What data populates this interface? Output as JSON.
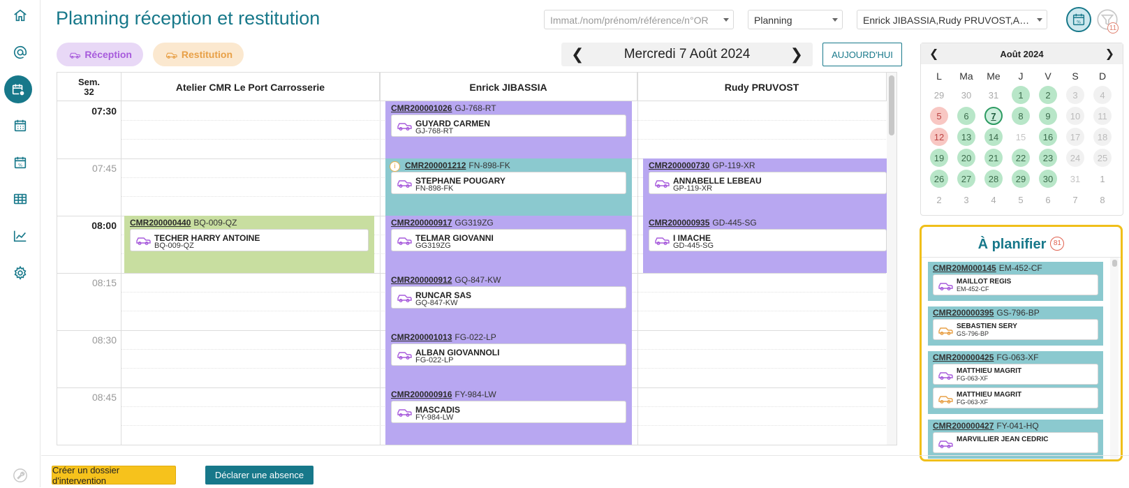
{
  "page": {
    "title": "Planning réception et restitution"
  },
  "header": {
    "search_placeholder": "Immat./nom/prénom/référence/n°OR",
    "view_select": "Planning",
    "people_select": "Enrick JIBASSIA,Rudy PRUVOST,Atel...",
    "filter_count": "11"
  },
  "chips": {
    "reception": "Réception",
    "restitution": "Restitution"
  },
  "date_nav": {
    "prev": "❮",
    "label": "Mercredi 7 Août 2024",
    "next": "❯",
    "today": "AUJOURD'HUI"
  },
  "grid": {
    "week_label": "Sem.",
    "week_number": "32",
    "columns": [
      "Atelier CMR Le Port Carrosserie",
      "Enrick JIBASSIA",
      "Rudy PRUVOST"
    ],
    "times": [
      "07:30",
      "07:45",
      "08:00",
      "08:15",
      "08:30",
      "08:45"
    ]
  },
  "appointments": {
    "e1": {
      "num": "CMR200001026",
      "plate": "GJ-768-RT",
      "name": "GUYARD CARMEN",
      "sub": "GJ-768-RT"
    },
    "e2": {
      "num": "CMR200001212",
      "plate": "FN-898-FK",
      "name": "STEPHANE POUGARY",
      "sub": "FN-898-FK",
      "info": "i"
    },
    "e3": {
      "num": "CMR200000917",
      "plate": "GG319ZG",
      "name": "TELMAR GIOVANNI",
      "sub": "GG319ZG"
    },
    "e4": {
      "num": "CMR200000912",
      "plate": "GQ-847-KW",
      "name": "RUNCAR SAS",
      "sub": "GQ-847-KW"
    },
    "e5": {
      "num": "CMR200001013",
      "plate": "FG-022-LP",
      "name": "ALBAN GIOVANNOLI",
      "sub": "FG-022-LP"
    },
    "e6": {
      "num": "CMR200000916",
      "plate": "FY-984-LW",
      "name": "MASCADIS",
      "sub": "FY-984-LW"
    },
    "a1": {
      "num": "CMR200000440",
      "plate": "BQ-009-QZ",
      "name": "TECHER HARRY ANTOINE",
      "sub": "BQ-009-QZ"
    },
    "r1": {
      "num": "CMR200000730",
      "plate": "GP-119-XR",
      "name": "ANNABELLE LEBEAU",
      "sub": "GP-119-XR"
    },
    "r2": {
      "num": "CMR200000935",
      "plate": "GD-445-SG",
      "name": "I IMACHE",
      "sub": "GD-445-SG"
    }
  },
  "mini_calendar": {
    "title": "Août 2024",
    "prev": "❮",
    "next": "❯",
    "dow": [
      "L",
      "Ma",
      "Me",
      "J",
      "V",
      "S",
      "D"
    ],
    "weeks": [
      [
        "29",
        "30",
        "31",
        "1",
        "2",
        "3",
        "4"
      ],
      [
        "5",
        "6",
        "7",
        "8",
        "9",
        "10",
        "11"
      ],
      [
        "12",
        "13",
        "14",
        "15",
        "16",
        "17",
        "18"
      ],
      [
        "19",
        "20",
        "21",
        "22",
        "23",
        "24",
        "25"
      ],
      [
        "26",
        "27",
        "28",
        "29",
        "30",
        "31",
        "1"
      ],
      [
        "2",
        "3",
        "4",
        "5",
        "6",
        "7",
        "8"
      ]
    ],
    "selected_day": "7"
  },
  "a_planifier": {
    "title": "À planifier",
    "count": "81",
    "items": [
      {
        "num": "CMR20M000145",
        "plate": "EM-452-CF",
        "cards": [
          {
            "type": "reception",
            "name": "MAILLOT REGIS",
            "sub": "EM-452-CF"
          }
        ]
      },
      {
        "num": "CMR200000395",
        "plate": "GS-796-BP",
        "cards": [
          {
            "type": "restitution",
            "name": "SEBASTIEN SERY",
            "sub": "GS-796-BP"
          }
        ]
      },
      {
        "num": "CMR200000425",
        "plate": "FG-063-XF",
        "cards": [
          {
            "type": "reception",
            "name": "MATTHIEU MAGRIT",
            "sub": "FG-063-XF"
          },
          {
            "type": "restitution",
            "name": "MATTHIEU MAGRIT",
            "sub": "FG-063-XF"
          }
        ]
      },
      {
        "num": "CMR200000427",
        "plate": "FY-041-HQ",
        "cards": [
          {
            "type": "reception",
            "name": "MARVILLIER JEAN CEDRIC",
            "sub": ""
          }
        ]
      }
    ]
  },
  "footer": {
    "create": "Créer un dossier d'intervention",
    "absence": "Déclarer une absence"
  },
  "colors": {
    "brand": "#17788a",
    "reception": "#a75bdc",
    "restitution": "#e8a047",
    "highlight": "#f0bf1a"
  },
  "icons": [
    "home-icon",
    "at-icon",
    "planning-calendar-icon",
    "calendar-grid-icon",
    "calendar-percent-icon",
    "table-icon",
    "chart-line-icon",
    "gear-icon",
    "wrench-icon",
    "filter-icon",
    "car-icon",
    "info-icon"
  ]
}
